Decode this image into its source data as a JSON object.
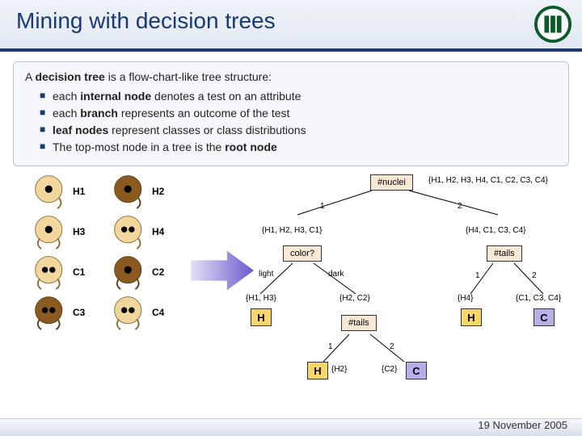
{
  "slide": {
    "title": "Mining with decision trees",
    "intro_prefix": "A ",
    "intro_bold": "decision tree",
    "intro_suffix": " is a flow-chart-like tree structure:",
    "bullets": [
      {
        "pre": "each ",
        "bold": "internal node",
        "post": " denotes a test on an attribute"
      },
      {
        "pre": "each ",
        "bold": "branch",
        "post": " represents an outcome of the test"
      },
      {
        "pre": "",
        "bold": "leaf nodes",
        "post": " represent classes or class distributions"
      },
      {
        "pre": "The top-most node in a tree is the ",
        "bold": "root node",
        "post": ""
      }
    ]
  },
  "cells": {
    "labels": [
      "H1",
      "H2",
      "H3",
      "H4",
      "C1",
      "C2",
      "C3",
      "C4"
    ]
  },
  "tree": {
    "root": {
      "label": "#nuclei",
      "set": "{H1, H2, H3, H4, C1, C2, C3, C4}",
      "left_out": "1",
      "right_out": "2"
    },
    "L": {
      "set": "{H1, H2, H3, C1}",
      "node": "color?",
      "left_out": "light",
      "right_out": "dark",
      "LL": {
        "set": "{H1, H3}",
        "leaf": "H"
      },
      "LR": {
        "set": "{H2, C2}",
        "node": "#tails",
        "left_out": "1",
        "right_out": "2",
        "L": {
          "set": "{H2}",
          "leaf": "H"
        },
        "R": {
          "set": "{C2}",
          "leaf": "C"
        }
      }
    },
    "R": {
      "set": "{H4, C1, C3, C4}",
      "node": "#tails",
      "left_out": "1",
      "right_out": "2",
      "RL": {
        "set": "{H4}",
        "leaf": "H"
      },
      "RR": {
        "set": "{C1, C3, C4}",
        "leaf": "C"
      }
    }
  },
  "footer": {
    "date": "19 November 2005"
  },
  "colors": {
    "accent": "#1a3a73",
    "attr_fill": "#f8e9d6",
    "leaf_h": "#f8d66c",
    "leaf_c": "#b7b0e8"
  }
}
